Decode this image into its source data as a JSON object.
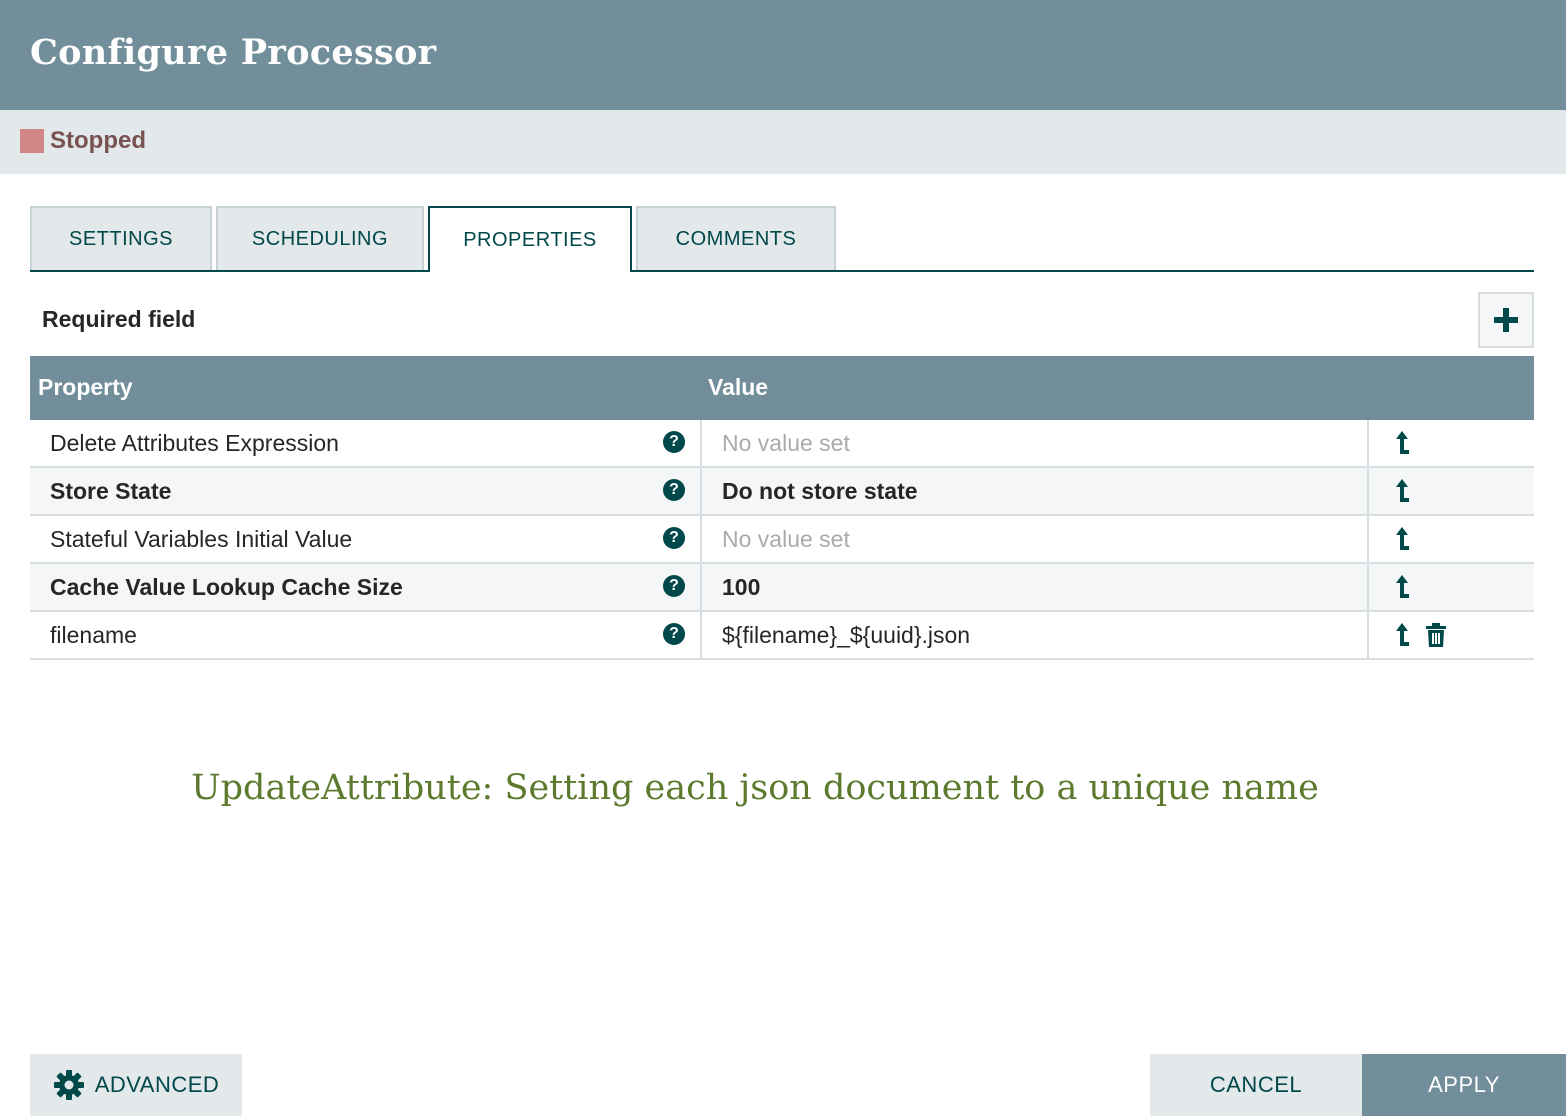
{
  "dialog": {
    "title": "Configure Processor"
  },
  "status": {
    "label": "Stopped",
    "color": "#d18686"
  },
  "tabs": [
    {
      "label": "SETTINGS",
      "active": false
    },
    {
      "label": "SCHEDULING",
      "active": false
    },
    {
      "label": "PROPERTIES",
      "active": true
    },
    {
      "label": "COMMENTS",
      "active": false
    }
  ],
  "properties": {
    "required_label": "Required field",
    "add_icon": "plus-icon",
    "columns": {
      "property": "Property",
      "value": "Value"
    },
    "rows": [
      {
        "name": "Delete Attributes Expression",
        "value": "No value set",
        "required": false,
        "empty": true,
        "deletable": false
      },
      {
        "name": "Store State",
        "value": "Do not store state",
        "required": true,
        "empty": false,
        "deletable": false
      },
      {
        "name": "Stateful Variables Initial Value",
        "value": "No value set",
        "required": false,
        "empty": true,
        "deletable": false
      },
      {
        "name": "Cache Value Lookup Cache Size",
        "value": "100",
        "required": true,
        "empty": false,
        "deletable": false
      },
      {
        "name": "filename",
        "value": "${filename}_${uuid}.json",
        "required": false,
        "empty": false,
        "deletable": true
      }
    ],
    "help_glyph": "?"
  },
  "caption": "UpdateAttribute: Setting each json document to a unique name",
  "footer": {
    "advanced_label": "ADVANCED",
    "cancel_label": "CANCEL",
    "apply_label": "APPLY"
  },
  "colors": {
    "header_bg": "#728e9b",
    "accent": "#004849",
    "caption": "#5c7a2e"
  }
}
